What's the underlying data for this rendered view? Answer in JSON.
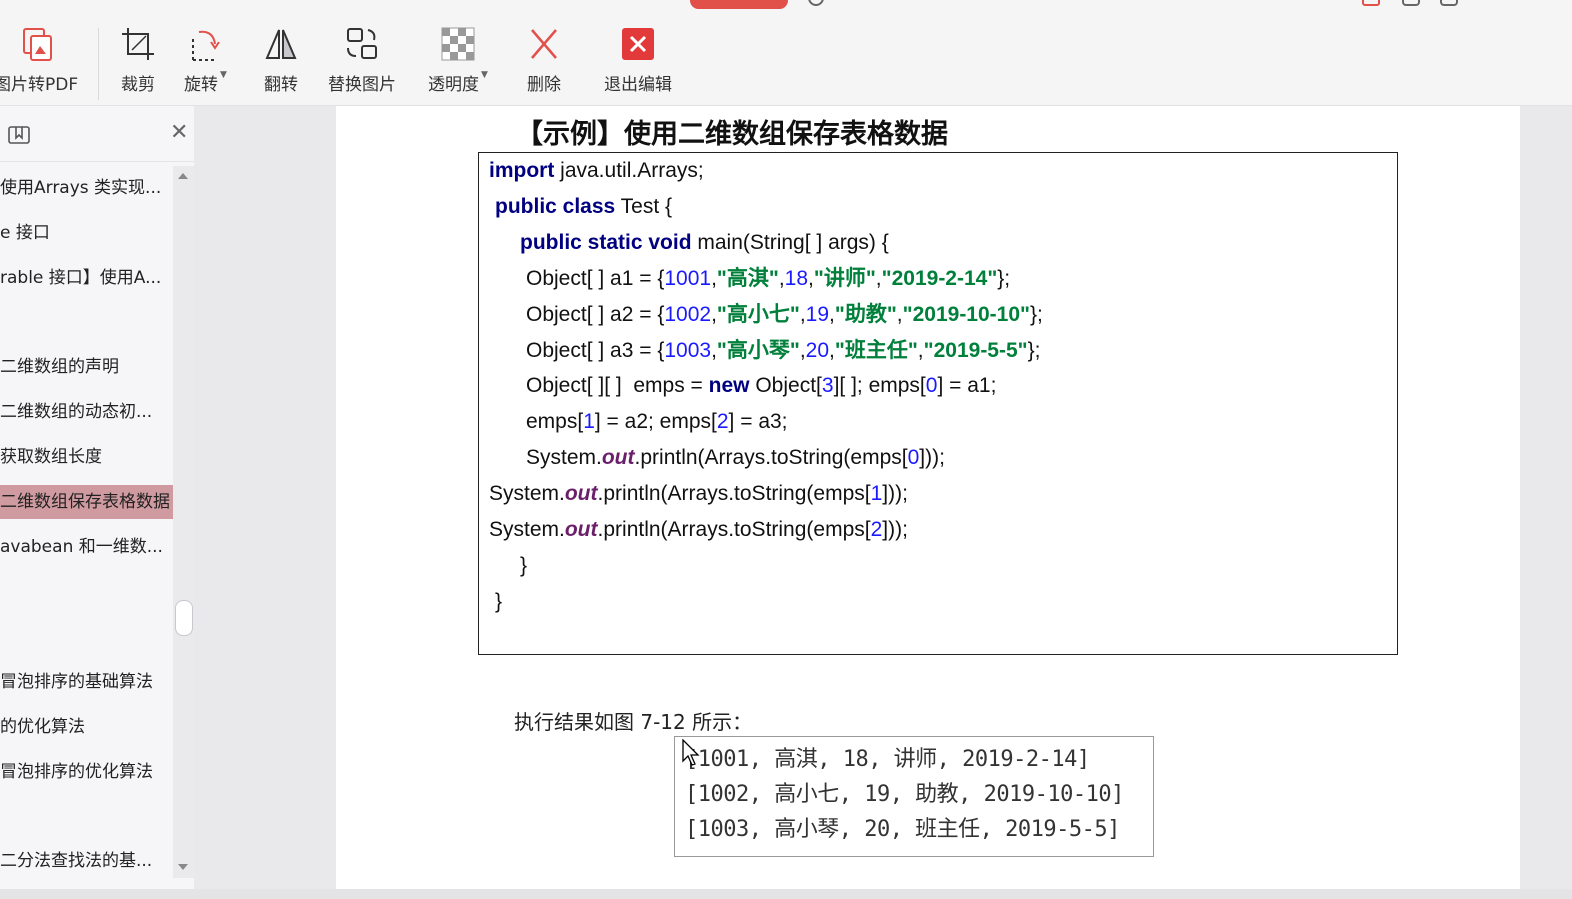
{
  "colors": {
    "accent": "#e2504a",
    "active_item": "#cf9aa0",
    "keyword": "#000080",
    "number": "#1a1aff",
    "string": "#00803a",
    "field": "#6b1f6b"
  },
  "toolbar": {
    "items": [
      {
        "label": "图片转PDF",
        "icon": "image-to-pdf-icon"
      },
      {
        "label": "裁剪",
        "icon": "crop-icon"
      },
      {
        "label": "旋转",
        "icon": "rotate-icon"
      },
      {
        "label": "翻转",
        "icon": "flip-icon"
      },
      {
        "label": "替换图片",
        "icon": "replace-image-icon"
      },
      {
        "label": "透明度",
        "icon": "transparency-icon"
      },
      {
        "label": "删除",
        "icon": "delete-icon"
      },
      {
        "label": "退出编辑",
        "icon": "exit-edit-icon"
      }
    ]
  },
  "sidebar": {
    "items": [
      "使用Arrays 类实现...",
      "e 接口",
      "rable 接口】使用A...",
      "二维数组的声明",
      "二维数组的动态初...",
      "获取数组长度",
      "二维数组保存表格数据",
      "avabean 和一维数...",
      "冒泡排序的基础算法",
      "的优化算法",
      "冒泡排序的优化算法",
      "二分法查找法的基..."
    ]
  },
  "document": {
    "heading": "【示例】使用二维数组保存表格数据",
    "result_label": "执行结果如图 7-12 所示：",
    "output_lines": [
      "[1001, 高淇, 18, 讲师, 2019-2-14]",
      "[1002, 高小七, 19, 助教, 2019-10-10]",
      "[1003, 高小琴, 20, 班主任, 2019-5-5]"
    ]
  }
}
